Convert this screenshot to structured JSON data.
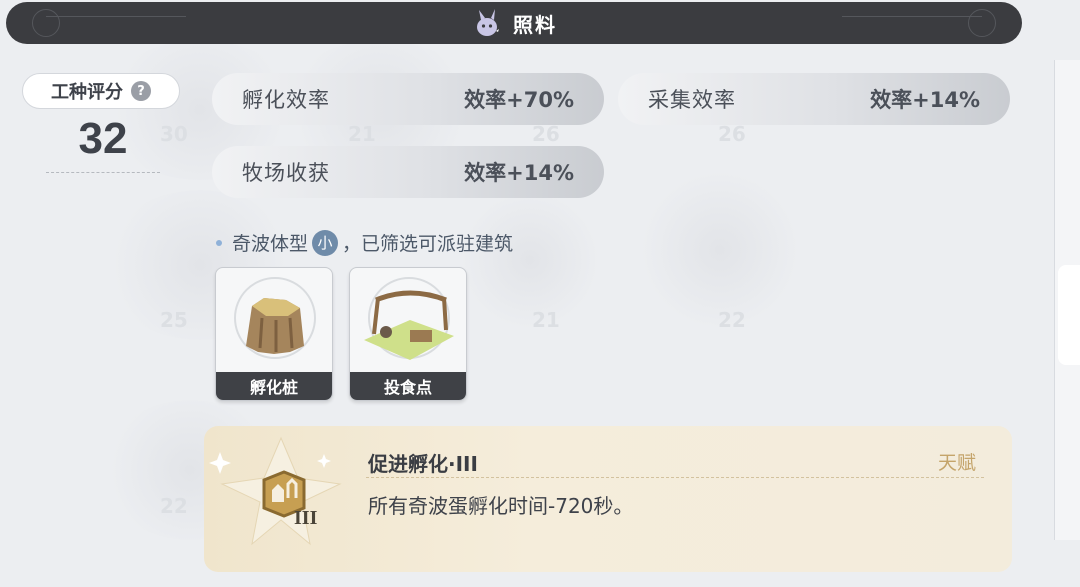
{
  "header": {
    "title": "照料",
    "icon": "qibo-creature-icon"
  },
  "score": {
    "label": "工种评分",
    "help_icon": "?",
    "value": "32"
  },
  "stats": [
    {
      "name": "孵化效率",
      "value": "效率+70%"
    },
    {
      "name": "采集效率",
      "value": "效率+14%"
    },
    {
      "name": "牧场收获",
      "value": "效率+14%"
    }
  ],
  "filter": {
    "prefix": "奇波体型",
    "size": "小",
    "suffix": "，已筛选可派驻建筑"
  },
  "buildings": [
    {
      "label": "孵化桩",
      "icon": "hatching-stump-icon"
    },
    {
      "label": "投食点",
      "icon": "feeding-spot-icon"
    }
  ],
  "talent": {
    "title": "促进孵化·III",
    "tag": "天赋",
    "description": "所有奇波蛋孵化时间-720秒。",
    "badge": "III",
    "icon": "hatch-boost-badge-icon"
  },
  "background_ghost_numbers": [
    "30",
    "21",
    "26",
    "26",
    "25",
    "21",
    "22",
    "22"
  ],
  "colors": {
    "header_bg": "#3b3c40",
    "talent_bg": "#f3ead6",
    "accent_gold": "#c4a46a",
    "size_badge": "#6f8ba9"
  }
}
